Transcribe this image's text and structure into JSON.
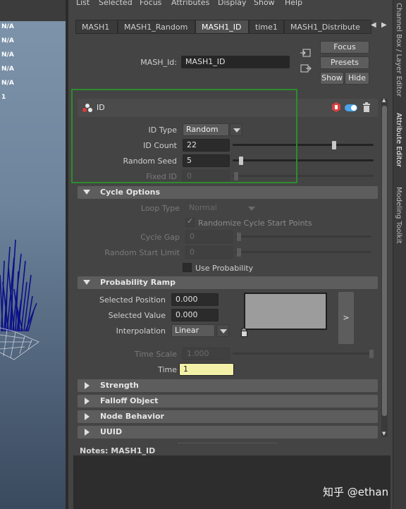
{
  "menu": [
    "List",
    "Selected",
    "Focus",
    "Attributes",
    "Display",
    "Show",
    "Help"
  ],
  "viewport": {
    "rows": [
      "N/A",
      "N/A",
      "N/A",
      "N/A",
      "N/A",
      "1"
    ]
  },
  "tabs": [
    {
      "label": "MASH1",
      "active": false
    },
    {
      "label": "MASH1_Random",
      "active": false
    },
    {
      "label": "MASH1_ID",
      "active": true
    },
    {
      "label": "time1",
      "active": false
    },
    {
      "label": "MASH1_Distribute",
      "active": false
    }
  ],
  "node": {
    "label": "MASH_Id:",
    "value": "MASH1_ID",
    "focus": "Focus",
    "presets": "Presets",
    "show": "Show",
    "hide": "Hide"
  },
  "id_section": {
    "title": "ID",
    "id_type_label": "ID Type",
    "id_type_value": "Random",
    "id_count_label": "ID Count",
    "id_count_value": "22",
    "id_count_fraction": 0.72,
    "random_seed_label": "Random Seed",
    "random_seed_value": "5",
    "random_seed_fraction": 0.06,
    "fixed_id_label": "Fixed ID",
    "fixed_id_value": "0"
  },
  "cycle": {
    "title": "Cycle Options",
    "loop_type_label": "Loop Type",
    "loop_type_value": "Normal",
    "randomize_label": "Randomize Cycle Start Points",
    "cycle_gap_label": "Cycle Gap",
    "cycle_gap_value": "0",
    "random_start_label": "Random Start Limit",
    "random_start_value": "0",
    "use_probability_label": "Use Probability"
  },
  "ramp": {
    "title": "Probability Ramp",
    "selected_position_label": "Selected Position",
    "selected_position_value": "0.000",
    "selected_value_label": "Selected Value",
    "selected_value_value": "0.000",
    "interpolation_label": "Interpolation",
    "interpolation_value": "Linear",
    "expand": ">"
  },
  "time": {
    "time_scale_label": "Time Scale",
    "time_scale_value": "1.000",
    "time_label": "Time",
    "time_value": "1"
  },
  "collapsed_sections": [
    "Strength",
    "Falloff Object",
    "Node Behavior",
    "UUID"
  ],
  "notes_label": "Notes:  MASH1_ID",
  "side_tabs": [
    {
      "label": "Channel Box / Layer Editor",
      "active": false
    },
    {
      "label": "Attribute Editor",
      "active": true
    },
    {
      "label": "Modeling Toolkit",
      "active": false
    }
  ],
  "watermark": "知乎 @ethan",
  "colors": {
    "highlight": "#2e8b2e",
    "time_field": "#f3f0a8",
    "viewport_mesh": "#0c0f8a"
  }
}
